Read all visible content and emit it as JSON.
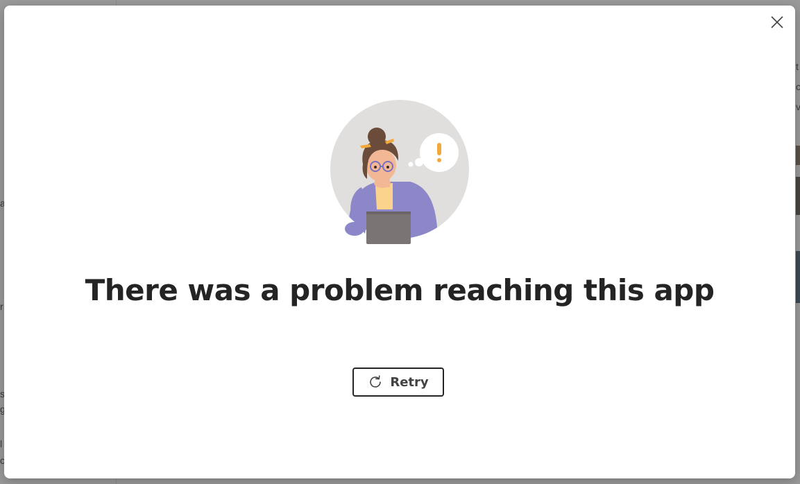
{
  "dialog": {
    "heading": "There was a problem reaching this app",
    "retry_label": "Retry"
  },
  "illustration": {
    "alert_symbol": "!"
  },
  "background": {
    "right_chars": [
      "t",
      "c",
      "v"
    ],
    "left_chars": [
      "a",
      "r",
      "s",
      "g",
      "l",
      "c"
    ]
  },
  "icons": {
    "close": "close-icon",
    "retry": "refresh-icon"
  },
  "colors": {
    "heading": "#242424",
    "button_border": "#242424",
    "illustration_circle": "#e1dfdd",
    "alert": "#f2a93b",
    "sweater": "#8b87c9"
  }
}
